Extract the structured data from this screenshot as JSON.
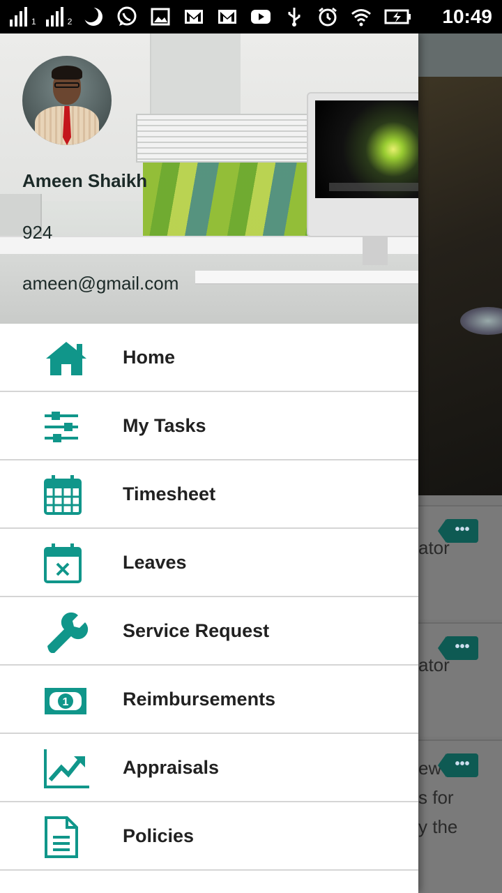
{
  "status_bar": {
    "time": "10:49",
    "sim1_label": "1",
    "sim2_label": "2",
    "icons": [
      "signal-icon",
      "signal-icon",
      "moon-icon",
      "whatsapp-icon",
      "image-icon",
      "gmail-icon",
      "gmail-icon",
      "youtube-icon",
      "usb-icon",
      "alarm-icon",
      "wifi-icon",
      "battery-charging-icon"
    ]
  },
  "user": {
    "name": "Ameen Shaikh",
    "id": "924",
    "email": "ameen@gmail.com"
  },
  "menu": [
    {
      "label": "Home",
      "icon": "home-icon"
    },
    {
      "label": "My Tasks",
      "icon": "sliders-icon"
    },
    {
      "label": "Timesheet",
      "icon": "calendar-grid-icon"
    },
    {
      "label": "Leaves",
      "icon": "calendar-x-icon"
    },
    {
      "label": "Service Request",
      "icon": "wrench-icon"
    },
    {
      "label": "Reimbursements",
      "icon": "money-icon"
    },
    {
      "label": "Appraisals",
      "icon": "trend-chart-icon"
    },
    {
      "label": "Policies",
      "icon": "document-icon"
    }
  ],
  "background_cards": [
    {
      "text": "ator",
      "tag": "•••"
    },
    {
      "text": "ator",
      "tag": "•••"
    },
    {
      "text": "ew\ns for\ny the",
      "tag": "•••"
    }
  ],
  "colors": {
    "accent": "#10968a",
    "status_bar_bg": "#000000",
    "drawer_bg": "#ffffff",
    "menu_text": "#212121"
  }
}
